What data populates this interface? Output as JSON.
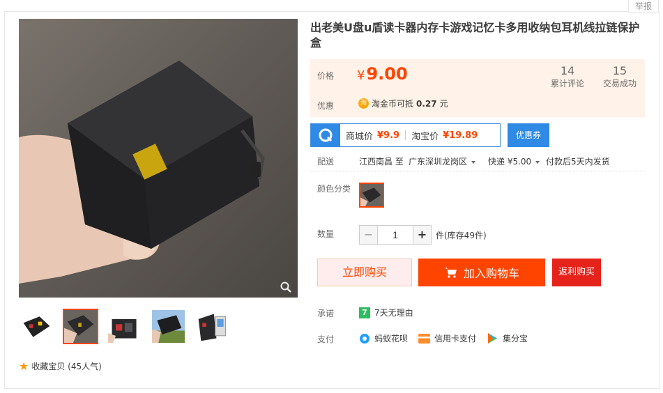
{
  "header": {
    "report_label": "举报"
  },
  "gallery": {
    "thumbs": [
      "thumb-1",
      "thumb-2",
      "thumb-3",
      "thumb-4",
      "thumb-5"
    ],
    "active_thumb": 2
  },
  "collect": {
    "label": "收藏宝贝 (45人气)"
  },
  "product": {
    "title": "出老美U盘u盾读卡器内存卡游戏记忆卡多用收纳包耳机线拉链保护盒"
  },
  "price_box": {
    "price_label": "价格",
    "currency": "¥",
    "price": "9.00",
    "reviews_count": "14",
    "reviews_label": "累计评论",
    "trades_count": "15",
    "trades_label": "交易成功",
    "promo_label": "优惠",
    "coin_glyph": "淘",
    "promo_text": "淘金币可抵",
    "promo_amount": "0.27",
    "promo_unit": "元"
  },
  "mall": {
    "mall_price_label": "商城价",
    "mall_price": "¥9.9",
    "taobao_price_label": "淘宝价",
    "taobao_price": "¥19.89",
    "coupon_label": "优惠券"
  },
  "shipping": {
    "label": "配送",
    "from": "江西南昌 至",
    "to": "广东深圳龙岗区",
    "express": "快递 ¥5.00",
    "dispatch": "付款后5天内发货"
  },
  "sku": {
    "color_label": "颜色分类"
  },
  "quantity": {
    "label": "数量",
    "value": "1",
    "stock": "件(库存49件)"
  },
  "actions": {
    "buy_now": "立即购买",
    "add_cart": "加入购物车",
    "rebate_buy": "返利购买"
  },
  "promise": {
    "label": "承诺",
    "badge": "7",
    "text": "7天无理由"
  },
  "payment": {
    "label": "支付",
    "methods": [
      {
        "name": "蚂蚁花呗",
        "icon": "huabei-icon",
        "color": "#1e9fff"
      },
      {
        "name": "信用卡支付",
        "icon": "credit-card-icon",
        "color": "#ff8c2b"
      },
      {
        "name": "集分宝",
        "icon": "jifenbao-icon",
        "color": "#2bb0ee"
      }
    ]
  },
  "colors": {
    "accent": "#ff4400",
    "price_bg": "#fff2e8",
    "mall_blue": "#2f8ae5"
  }
}
